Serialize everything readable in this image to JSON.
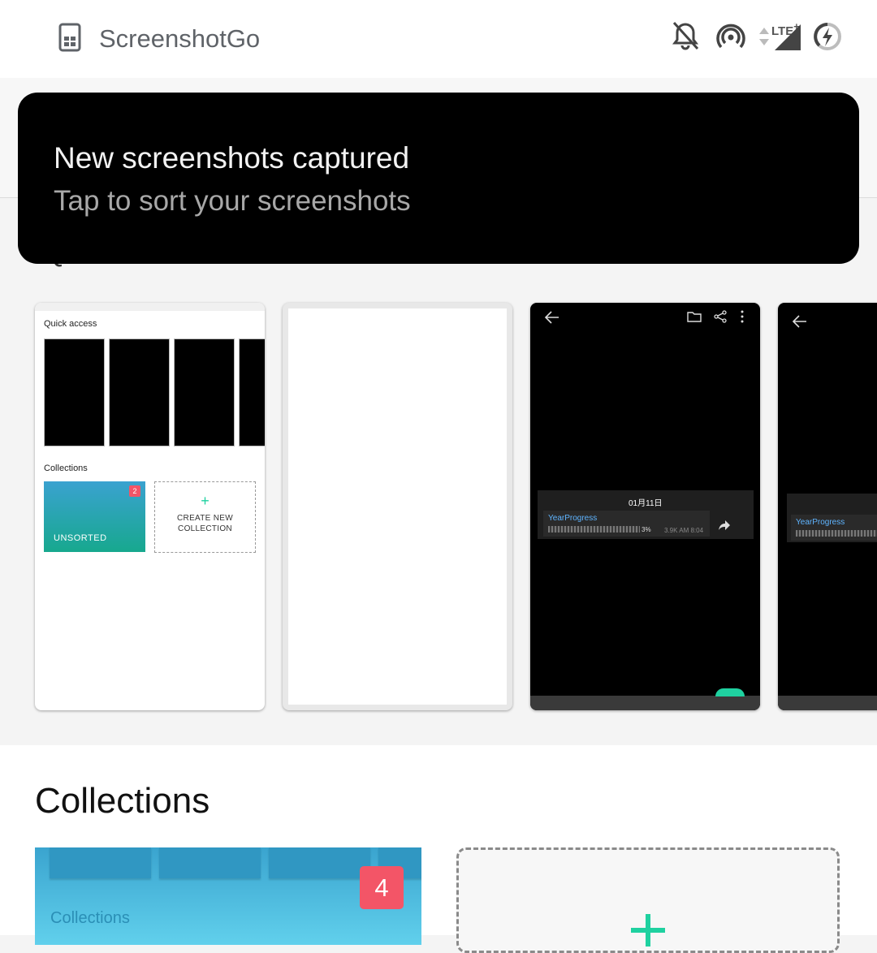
{
  "statusbar": {
    "app_name": "ScreenshotGo",
    "network_label": "LTE",
    "network_plus": "+"
  },
  "notification": {
    "title": "New screenshots captured",
    "subtitle": "Tap to sort your screenshots"
  },
  "quick_access": {
    "hidden_heading": "Quick access",
    "preview": {
      "quick_access_label": "Quick access",
      "collections_label": "Collections",
      "unsorted_label": "UNSORTED",
      "unsorted_badge": "2",
      "create_new_line1": "CREATE NEW",
      "create_new_line2": "COLLECTION"
    },
    "dark_card": {
      "date": "01月11日",
      "channel": "YearProgress",
      "percent": "3%",
      "meta": "3.9K  AM 8:04",
      "progress_fraction": 0.03
    },
    "partial_card": {
      "channel": "YearProgress"
    }
  },
  "collections": {
    "heading": "Collections",
    "first_label": "Collections",
    "first_badge": "4"
  },
  "colors": {
    "accent": "#1fd1a0",
    "badge": "#f35567",
    "link_blue": "#5fb4ff"
  }
}
